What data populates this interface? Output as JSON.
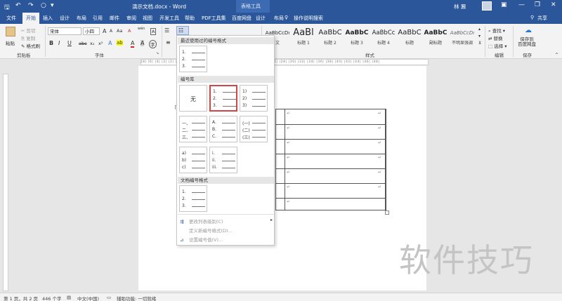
{
  "window": {
    "doc_title": "演示文档.docx  -  Word",
    "context_title": "表格工具",
    "user": "林 鼐",
    "tell_me": "操作说明搜索",
    "share": "共享"
  },
  "tabs": [
    "文件",
    "开始",
    "插入",
    "设计",
    "布局",
    "引用",
    "邮件",
    "审阅",
    "视图",
    "开发工具",
    "帮助",
    "PDF工具集",
    "百度网盘",
    "设计",
    "布局"
  ],
  "ribbon": {
    "clipboard": {
      "paste": "粘贴",
      "cut": "剪切",
      "copy": "复制",
      "format_painter": "格式刷",
      "label": "剪贴板"
    },
    "font": {
      "name": "宋体",
      "size": "小四",
      "label": "字体",
      "wen": "wén",
      "a_big": "A",
      "a_small": "A",
      "aa": "Aa",
      "clear": "A",
      "char_border": "A",
      "bold": "B",
      "italic": "I",
      "underline": "U",
      "strike": "abc",
      "sub": "x₂",
      "sup": "x²",
      "effects": "A",
      "highlight": "ab",
      "color": "A",
      "shade": "A",
      "circle": "字"
    },
    "styles": {
      "label": "样式",
      "items": [
        {
          "preview": "AaBbCcDı",
          "name": "文"
        },
        {
          "preview": "AaBl",
          "name": "标题 1"
        },
        {
          "preview": "AaBbC",
          "name": "标题 2"
        },
        {
          "preview": "AaBbC",
          "name": "标题 3"
        },
        {
          "preview": "AaBbCc",
          "name": "标题 4"
        },
        {
          "preview": "AaBbC",
          "name": "标题"
        },
        {
          "preview": "AaBbC",
          "name": "副标题"
        },
        {
          "preview": "AaBbCcDı",
          "name": "不明显强调"
        }
      ]
    },
    "editing": {
      "find": "查找",
      "replace": "替换",
      "select": "选择",
      "label": "编辑"
    },
    "save": {
      "button": "保存到\n百度网盘",
      "label": "保存"
    }
  },
  "ruler": "|8|  |6|  |4|  |2|    |2|  |4|  |6|  |8|  |10|  |12|  |14|  |16|  |18|  |20|  |22|  |24|  |26|  |28|  |30|  |32|  |34|  |36|  |38|  |40|  |42|  |44|  |46|  |48|",
  "numbering": {
    "recent_header": "最近使用过的编号格式",
    "library_header": "编号库",
    "document_header": "文档编号格式",
    "none_label": "无",
    "recent": [
      [
        "1.",
        "2.",
        "3."
      ]
    ],
    "library": [
      {
        "id": "none"
      },
      {
        "id": "decimal-dot",
        "items": [
          "1.",
          "2.",
          "3."
        ],
        "selected": true
      },
      {
        "id": "decimal-paren",
        "items": [
          "1)",
          "2)",
          "3)"
        ]
      },
      {
        "id": "chinese-comma",
        "items": [
          "一、",
          "二、",
          "三、"
        ]
      },
      {
        "id": "upper-alpha",
        "items": [
          "A.",
          "B.",
          "C."
        ]
      },
      {
        "id": "chinese-paren",
        "items": [
          "(一)",
          "(二)",
          "(三)"
        ]
      },
      {
        "id": "lower-alpha",
        "items": [
          "a)",
          "b)",
          "c)"
        ]
      },
      {
        "id": "lower-roman",
        "items": [
          "i.",
          "ii.",
          "iii."
        ]
      }
    ],
    "document": [
      [
        "1.",
        "2.",
        "3."
      ]
    ],
    "menu": {
      "change_level": "更改列表级别(C)",
      "define_new": "定义新编号格式(D)...",
      "set_value": "设置编号值(V)..."
    }
  },
  "status": {
    "page": "第 1 页，共 2 页",
    "words": "446 个字",
    "lang": "中文(中国)",
    "access": "辅助功能: 一切就绪"
  },
  "watermark": "软件技巧"
}
